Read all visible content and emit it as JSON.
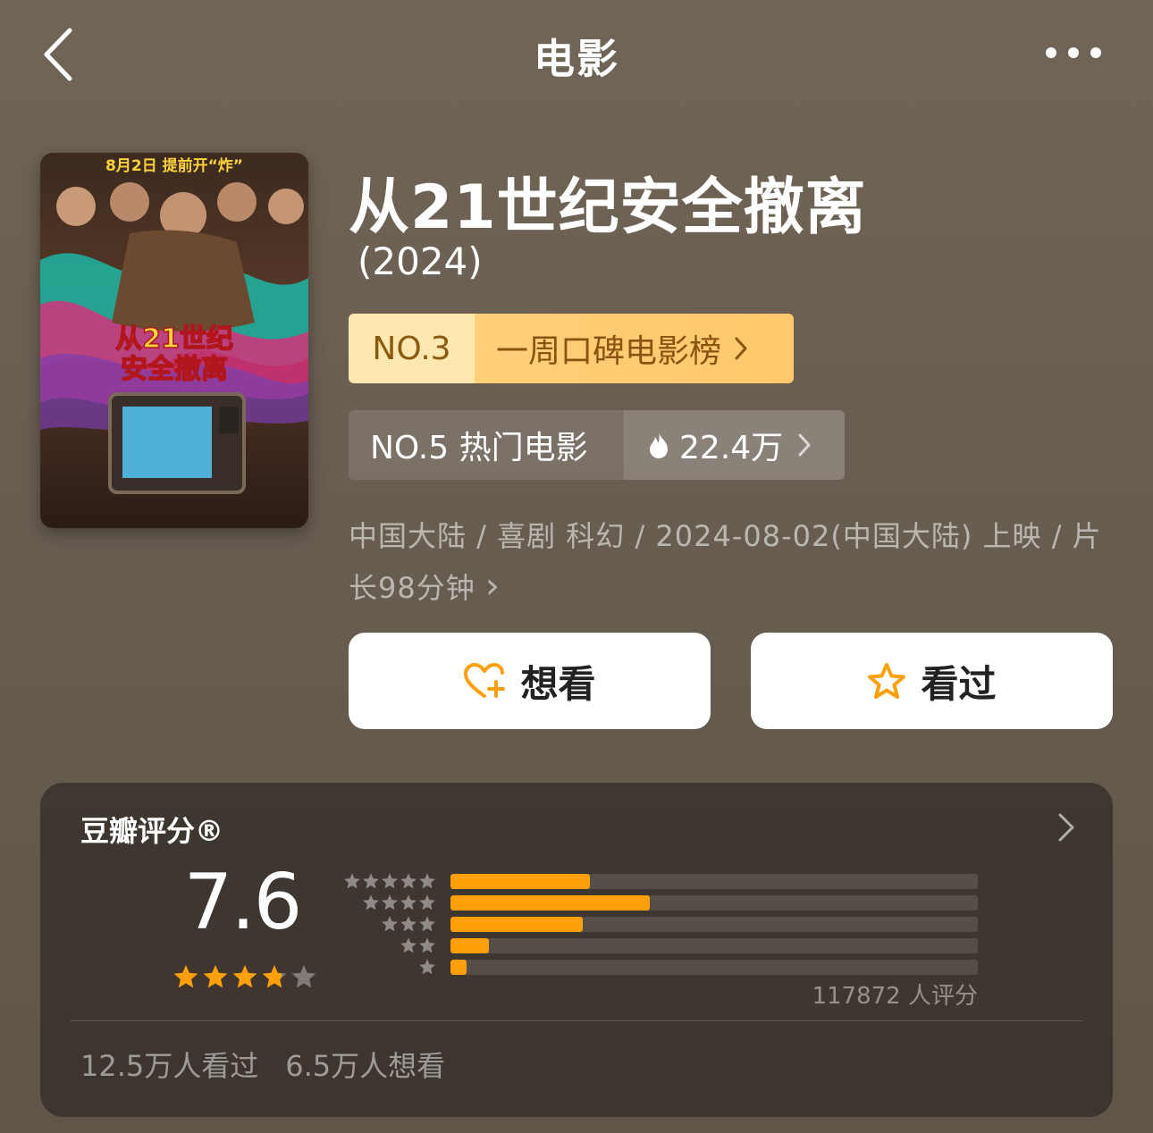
{
  "nav": {
    "title": "电影"
  },
  "movie": {
    "title": "从21世纪安全撤离",
    "year": "(2024)",
    "meta": "中国大陆 / 喜剧 科幻 / 2024-08-02(中国大陆) 上映 / 片长98分钟",
    "meta_chevron": "›"
  },
  "poster": {
    "date_text": "8月2日 提前开“炸”",
    "logo_line1": "从21世纪",
    "logo_line2": "安全撤离"
  },
  "ranks": {
    "word_of_mouth": {
      "num": "NO.3",
      "label": "一周口碑电影榜"
    },
    "hot": {
      "num": "NO.5 热门电影",
      "heat": "22.4万"
    }
  },
  "actions": {
    "want": "想看",
    "seen": "看过"
  },
  "rating": {
    "title": "豆瓣评分®",
    "score": "7.6",
    "stars": 3.8,
    "distribution": [
      {
        "stars": 5,
        "fraction": 0.265
      },
      {
        "stars": 4,
        "fraction": 0.378
      },
      {
        "stars": 3,
        "fraction": 0.25
      },
      {
        "stars": 2,
        "fraction": 0.073
      },
      {
        "stars": 1,
        "fraction": 0.03
      }
    ],
    "raters": "117872 人评分",
    "watched": "12.5万人看过",
    "want": "6.5万人想看"
  },
  "colors": {
    "accent": "#ff9f0a",
    "rank_bg": "#ffcf7a"
  }
}
